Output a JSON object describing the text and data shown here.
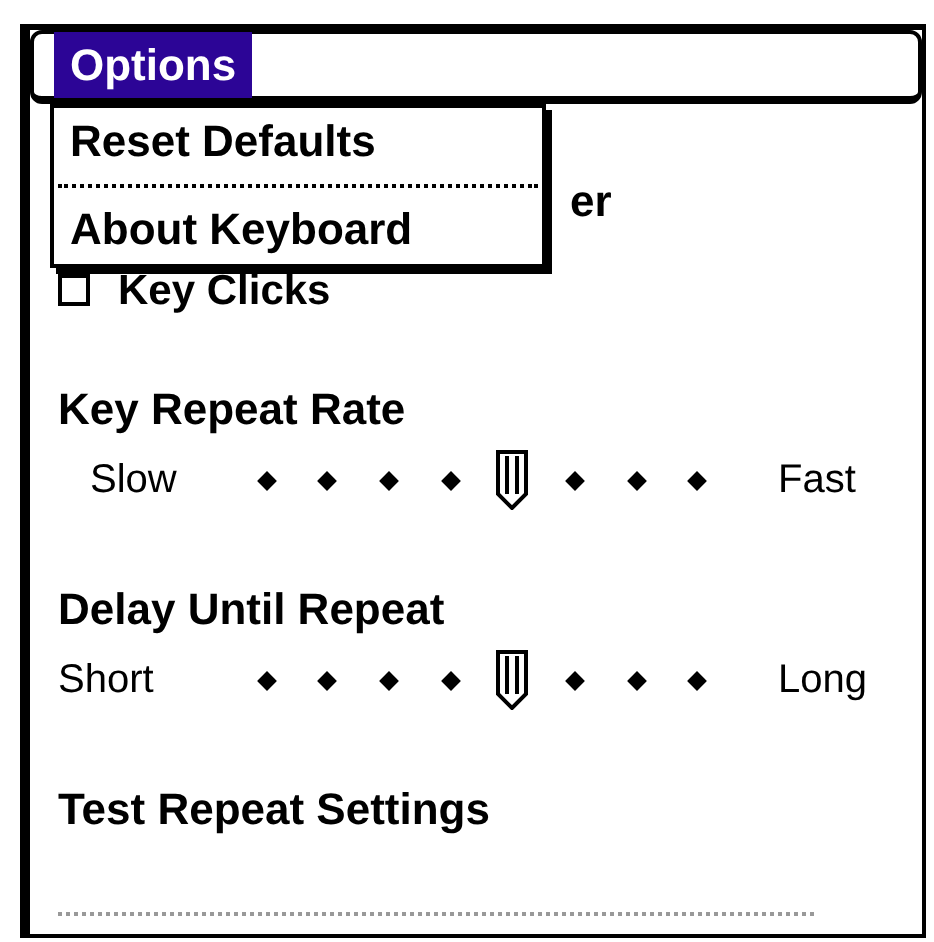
{
  "menu_bar": [
    {
      "label": "Options",
      "selected": true
    }
  ],
  "menu": {
    "items": [
      {
        "label": "Reset Defaults"
      },
      {
        "label": "About Keyboard"
      }
    ]
  },
  "covered_text": "er",
  "key_clicks": {
    "label": "Key Clicks",
    "checked": false
  },
  "sliders": [
    {
      "title": "Key Repeat Rate",
      "min_label": "Slow",
      "max_label": "Fast",
      "level": 0.571
    },
    {
      "title": "Delay Until Repeat",
      "min_label": "Short",
      "max_label": "Long",
      "level": 0.571
    }
  ],
  "test_field": {
    "label": "Test Repeat Settings"
  }
}
